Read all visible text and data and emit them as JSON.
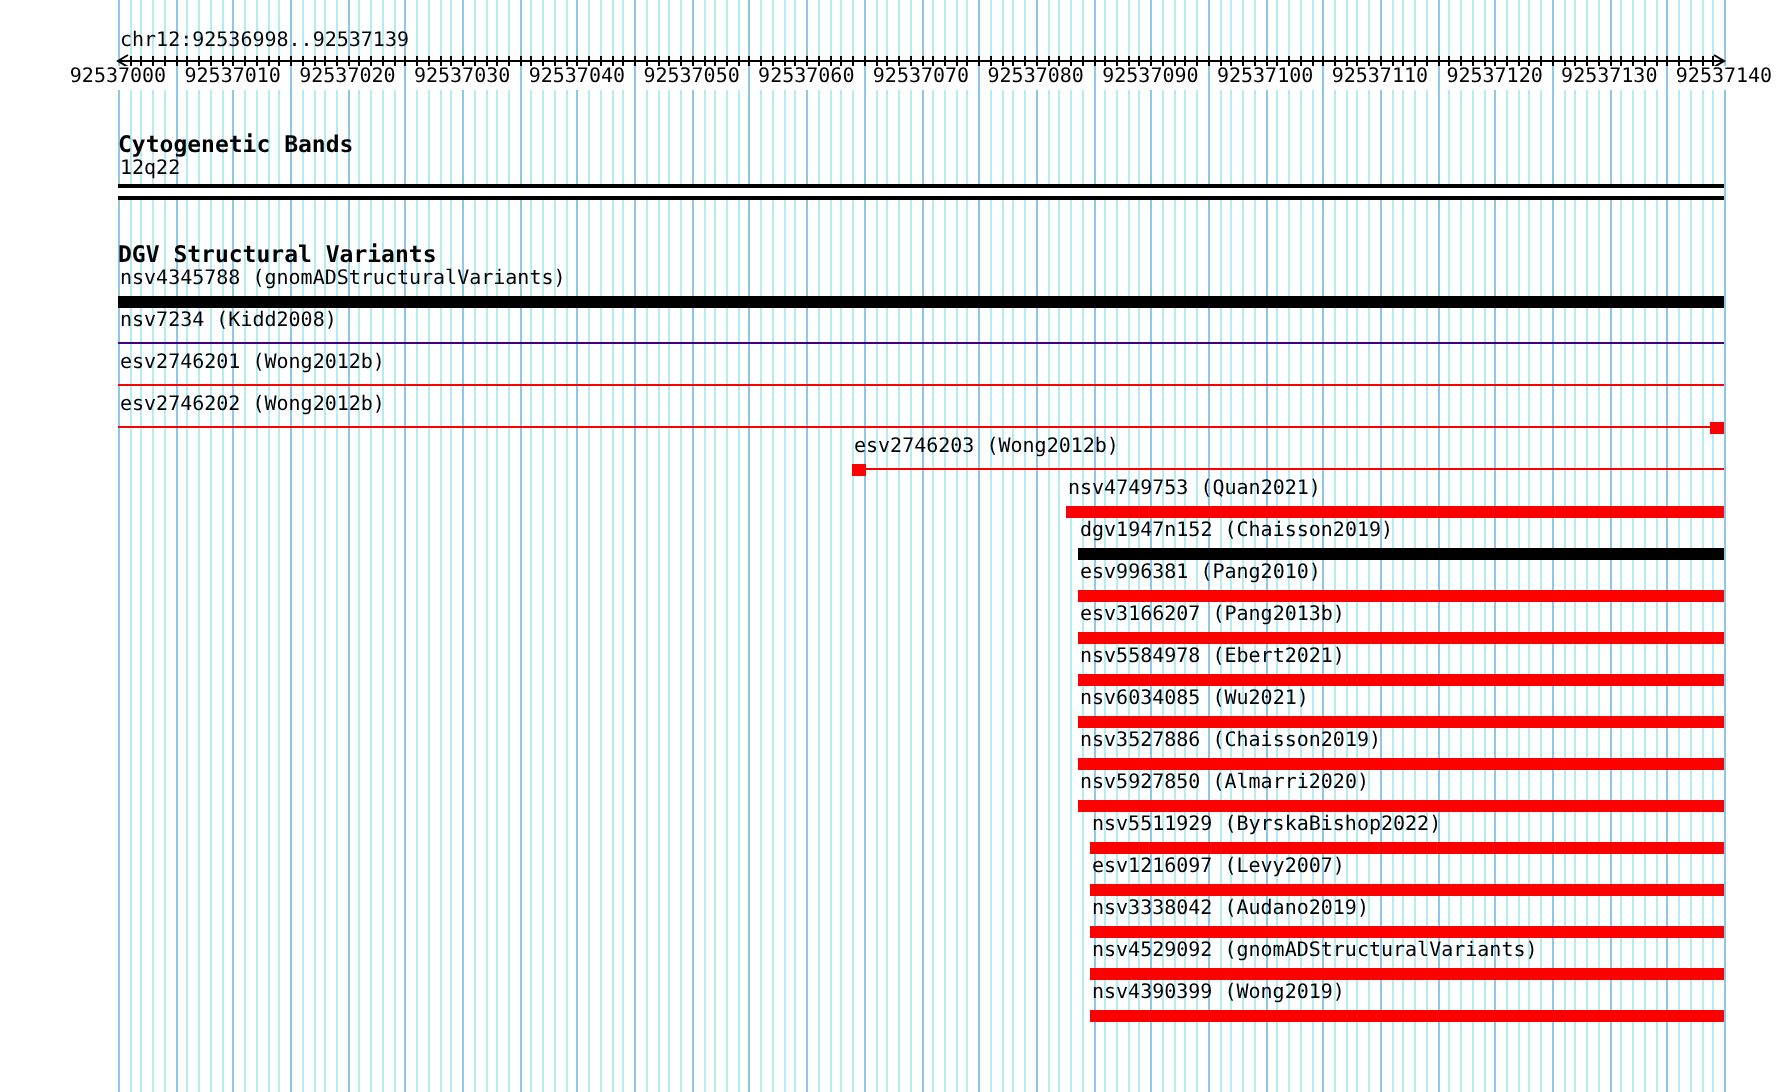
{
  "ruler": {
    "location": "chr12:92536998..92537139",
    "tick_labels": [
      "92537000",
      "92537010",
      "92537020",
      "92537030",
      "92537040",
      "92537050",
      "92537060",
      "92537070",
      "92537080",
      "92537090",
      "92537100",
      "92537110",
      "92537120",
      "92537130",
      "92537140"
    ]
  },
  "cytogenetic_bands": {
    "title": "Cytogenetic Bands",
    "band": "12q22"
  },
  "dgv_structural_variants": {
    "title": "DGV Structural Variants",
    "features": [
      {
        "label": "nsv4345788 (gnomADStructuralVariants)",
        "color": "#000000",
        "kind": "bar"
      },
      {
        "label": "nsv7234 (Kidd2008)",
        "color": "#400080",
        "kind": "line"
      },
      {
        "label": "esv2746201 (Wong2012b)",
        "color": "#ff0000",
        "kind": "line"
      },
      {
        "label": "esv2746202 (Wong2012b)",
        "color": "#ff0000",
        "kind": "endblock"
      },
      {
        "label": "esv2746203 (Wong2012b)",
        "color": "#ff0000",
        "kind": "startblock"
      },
      {
        "label": "nsv4749753 (Quan2021)",
        "color": "#ff0000",
        "kind": "bar"
      },
      {
        "label": "dgv1947n152 (Chaisson2019)",
        "color": "#000000",
        "kind": "bar"
      },
      {
        "label": "esv996381 (Pang2010)",
        "color": "#ff0000",
        "kind": "bar"
      },
      {
        "label": "esv3166207 (Pang2013b)",
        "color": "#ff0000",
        "kind": "bar"
      },
      {
        "label": "nsv5584978 (Ebert2021)",
        "color": "#ff0000",
        "kind": "bar"
      },
      {
        "label": "nsv6034085 (Wu2021)",
        "color": "#ff0000",
        "kind": "bar"
      },
      {
        "label": "nsv3527886 (Chaisson2019)",
        "color": "#ff0000",
        "kind": "bar"
      },
      {
        "label": "nsv5927850 (Almarri2020)",
        "color": "#ff0000",
        "kind": "bar"
      },
      {
        "label": "nsv5511929 (ByrskaBishop2022)",
        "color": "#ff0000",
        "kind": "bar"
      },
      {
        "label": "esv1216097 (Levy2007)",
        "color": "#ff0000",
        "kind": "bar"
      },
      {
        "label": "nsv3338042 (Audano2019)",
        "color": "#ff0000",
        "kind": "bar"
      },
      {
        "label": "nsv4529092 (gnomADStructuralVariants)",
        "color": "#ff0000",
        "kind": "bar"
      },
      {
        "label": "nsv4390399 (Wong2019)",
        "color": "#ff0000",
        "kind": "bar"
      }
    ]
  }
}
